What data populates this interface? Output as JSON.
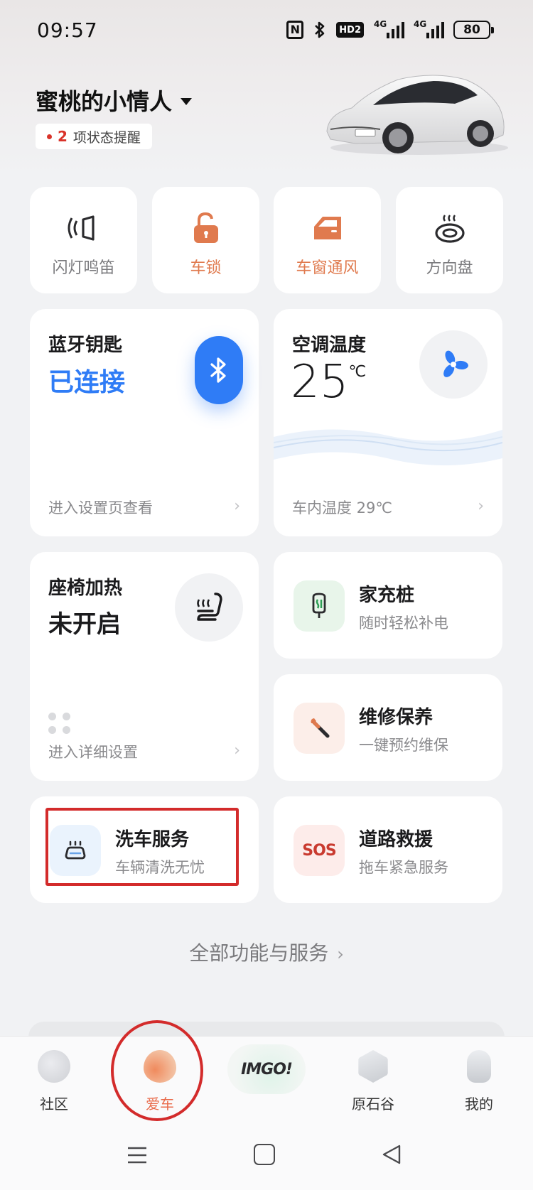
{
  "status_bar": {
    "time": "09:57",
    "nfc": "N",
    "hd": "HD2",
    "sig1": "4G",
    "sig2": "4G",
    "battery": "80"
  },
  "header": {
    "vehicle_name": "蜜桃的小情人",
    "alert_count": "2",
    "alert_text": "项状态提醒"
  },
  "quick_controls": [
    {
      "label": "闪灯鸣笛",
      "icon": "flash-horn-icon",
      "active": false
    },
    {
      "label": "车锁",
      "icon": "unlock-icon",
      "active": true
    },
    {
      "label": "车窗通风",
      "icon": "car-window-icon",
      "active": true
    },
    {
      "label": "方向盘",
      "icon": "steering-wheel-heat-icon",
      "active": false
    }
  ],
  "bluetooth_key": {
    "title": "蓝牙钥匙",
    "value": "已连接",
    "footer": "进入设置页查看",
    "chevron": "›",
    "accent": "#2f7cf6"
  },
  "ac": {
    "title": "空调温度",
    "value": "25",
    "unit": "℃",
    "footer": "车内温度 29℃",
    "chevron": "›"
  },
  "seat_heat": {
    "title": "座椅加热",
    "value": "未开启",
    "footer": "进入详细设置",
    "chevron": "›"
  },
  "services": [
    {
      "title": "家充桩",
      "subtitle": "随时轻松补电",
      "icon": "charger-icon",
      "icon_bg": "#e8f5ea"
    },
    {
      "title": "维修保养",
      "subtitle": "一键预约维保",
      "icon": "wrench-icon",
      "icon_bg": "#fceee9"
    },
    {
      "title": "洗车服务",
      "subtitle": "车辆清洗无忧",
      "icon": "car-wash-icon",
      "icon_bg": "#eaf3fd"
    },
    {
      "title": "道路救援",
      "subtitle": "拖车紧急服务",
      "icon": "sos-icon",
      "icon_bg": "#fdecea",
      "icon_text": "SOS"
    }
  ],
  "all_services": {
    "label": "全部功能与服务",
    "arrow": "›"
  },
  "bottom_nav": [
    {
      "label": "社区",
      "icon": "community-icon",
      "active": false
    },
    {
      "label": "爱车",
      "icon": "my-car-icon",
      "active": true
    },
    {
      "label": "IMGO!",
      "icon": "imgo-logo",
      "active": false
    },
    {
      "label": "原石谷",
      "icon": "stone-valley-icon",
      "active": false
    },
    {
      "label": "我的",
      "icon": "profile-icon",
      "active": false
    }
  ],
  "colors": {
    "accent_orange": "#e07a4e",
    "bluetooth_blue": "#2f7cf6",
    "highlight_red": "#d32b2b",
    "nav_active": "#e96a4a"
  }
}
